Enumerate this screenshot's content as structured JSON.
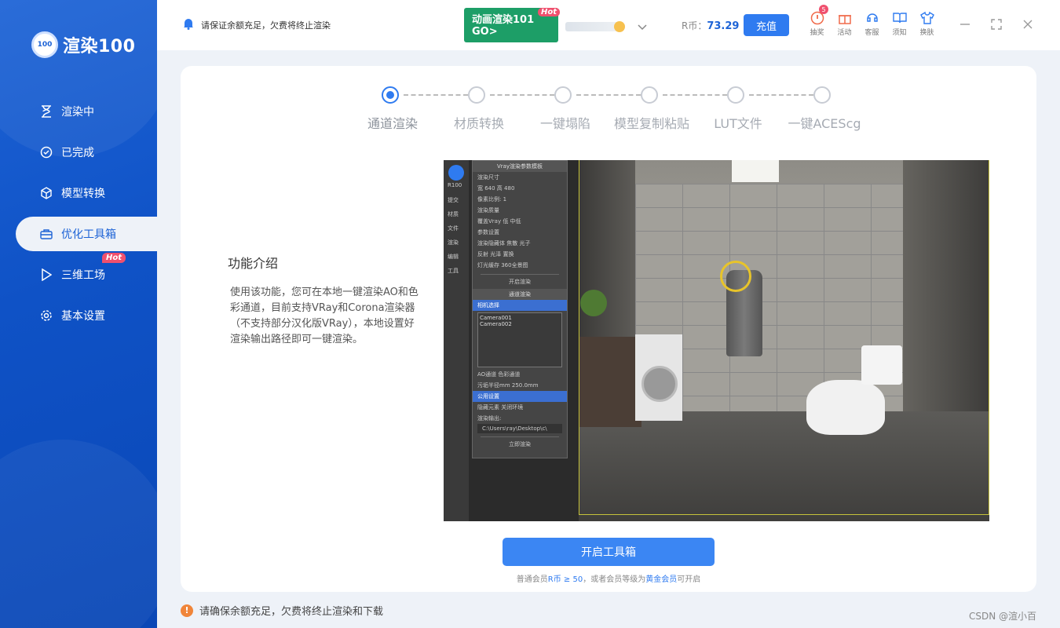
{
  "app": {
    "logo_badge": "100",
    "logo_text": "渲染100"
  },
  "sidebar": {
    "items": [
      {
        "label": "渲染中",
        "icon": "hourglass-icon"
      },
      {
        "label": "已完成",
        "icon": "check-circle-icon"
      },
      {
        "label": "模型转换",
        "icon": "cube-icon"
      },
      {
        "label": "优化工具箱",
        "icon": "toolbox-icon",
        "active": true
      },
      {
        "label": "三维工场",
        "icon": "play-icon",
        "tag": "Hot"
      },
      {
        "label": "基本设置",
        "icon": "gear-icon"
      }
    ]
  },
  "topbar": {
    "notice": "请保证余额充足，欠费将终止渲染",
    "promo": {
      "line1": "动画渲染101",
      "line2": "GO>",
      "tag": "Hot"
    },
    "rcoin_label": "R币：",
    "rcoin_value": "73.29",
    "recharge_label": "充值",
    "tools": [
      {
        "label": "抽奖",
        "icon": "lottery-icon",
        "badge": "5"
      },
      {
        "label": "活动",
        "icon": "gift-icon"
      },
      {
        "label": "客服",
        "icon": "headset-icon"
      },
      {
        "label": "须知",
        "icon": "book-icon"
      },
      {
        "label": "换肤",
        "icon": "shirt-icon"
      }
    ]
  },
  "steps": [
    {
      "label": "通道渲染",
      "active": true
    },
    {
      "label": "材质转换"
    },
    {
      "label": "一键塌陷"
    },
    {
      "label": "模型复制粘贴"
    },
    {
      "label": "LUT文件"
    },
    {
      "label": "一键ACEScg"
    }
  ],
  "intro": {
    "title": "功能介绍",
    "text": "使用该功能，您可在本地一键渲染AO和色彩通道，目前支持VRay和Corona渲染器（不支持部分汉化版VRay），本地设置好渲染输出路径即可一键渲染。"
  },
  "preview": {
    "rail_logo": "R100",
    "rail_items": [
      "提交",
      "材质",
      "文件",
      "渲染",
      "编辑",
      "工具"
    ],
    "panel_header": "Vray渲染参数模板",
    "panel_rows": [
      "渲染尺寸",
      "宽 640  高 480",
      "像素比例: 1",
      "渲染质量",
      "覆盖Vray  低  中低",
      "参数设置",
      "渲染隐藏体  焦散  光子",
      "反射  光泽  置换",
      "灯光缓存  360全景图",
      "开启渲染",
      "通道渲染",
      "相机选择"
    ],
    "cameras": [
      "Camera001",
      "Camera002"
    ],
    "panel_rows2": [
      "AO通道  色彩通道",
      "污垢半径mm 250.0mm",
      "公用设置",
      "隐藏元素  关闭环境",
      "渲染输出:",
      "C:\\Users\\ray\\Desktop\\c\\",
      "立即渲染"
    ]
  },
  "action": {
    "open_label": "开启工具箱",
    "note_prefix": "普通会员",
    "note_r": "R币 ≥ 50",
    "note_mid": "，或者会员等级为",
    "note_gold": "黄金会员",
    "note_suffix": "可开启"
  },
  "footer": {
    "warning": "请确保余额充足，欠费将终止渲染和下载",
    "warn_icon": "!",
    "watermark": "CSDN @渲小百"
  },
  "colors": {
    "accent": "#2f7bf0",
    "sidebar": "#1d63d6",
    "promo": "#1d9e67",
    "hot": "#f0506e",
    "warn": "#f0853a"
  }
}
